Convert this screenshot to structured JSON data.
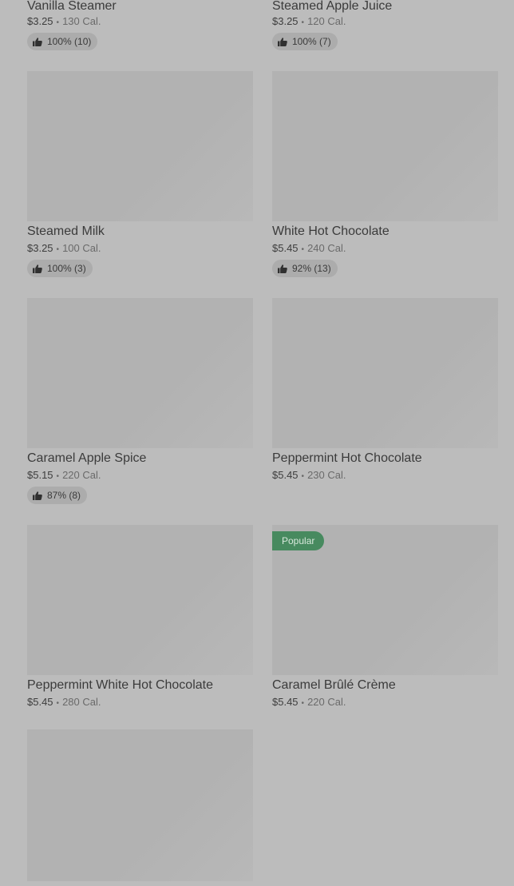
{
  "menu": {
    "items": [
      {
        "name": "Vanilla Steamer",
        "price": "$3.25",
        "calories": "130 Cal.",
        "rating": "100% (10)"
      },
      {
        "name": "Steamed Apple Juice",
        "price": "$3.25",
        "calories": "120 Cal.",
        "rating": "100% (7)"
      },
      {
        "name": "Steamed Milk",
        "price": "$3.25",
        "calories": "100 Cal.",
        "rating": "100% (3)"
      },
      {
        "name": "White Hot Chocolate",
        "price": "$5.45",
        "calories": "240 Cal.",
        "rating": "92% (13)"
      },
      {
        "name": "Caramel Apple Spice",
        "price": "$5.15",
        "calories": "220 Cal.",
        "rating": "87% (8)"
      },
      {
        "name": "Peppermint Hot Chocolate",
        "price": "$5.45",
        "calories": "230 Cal."
      },
      {
        "name": "Peppermint White Hot Chocolate",
        "price": "$5.45",
        "calories": "280 Cal."
      },
      {
        "name": "Caramel Brûlé Crème",
        "price": "$5.45",
        "calories": "220 Cal.",
        "badge": "Popular"
      }
    ]
  },
  "separator": "•",
  "icons": {
    "rating": "thumbs-up-icon"
  },
  "colors": {
    "popular_badge": "#478a5f",
    "overlay": "#bcbcbc"
  }
}
